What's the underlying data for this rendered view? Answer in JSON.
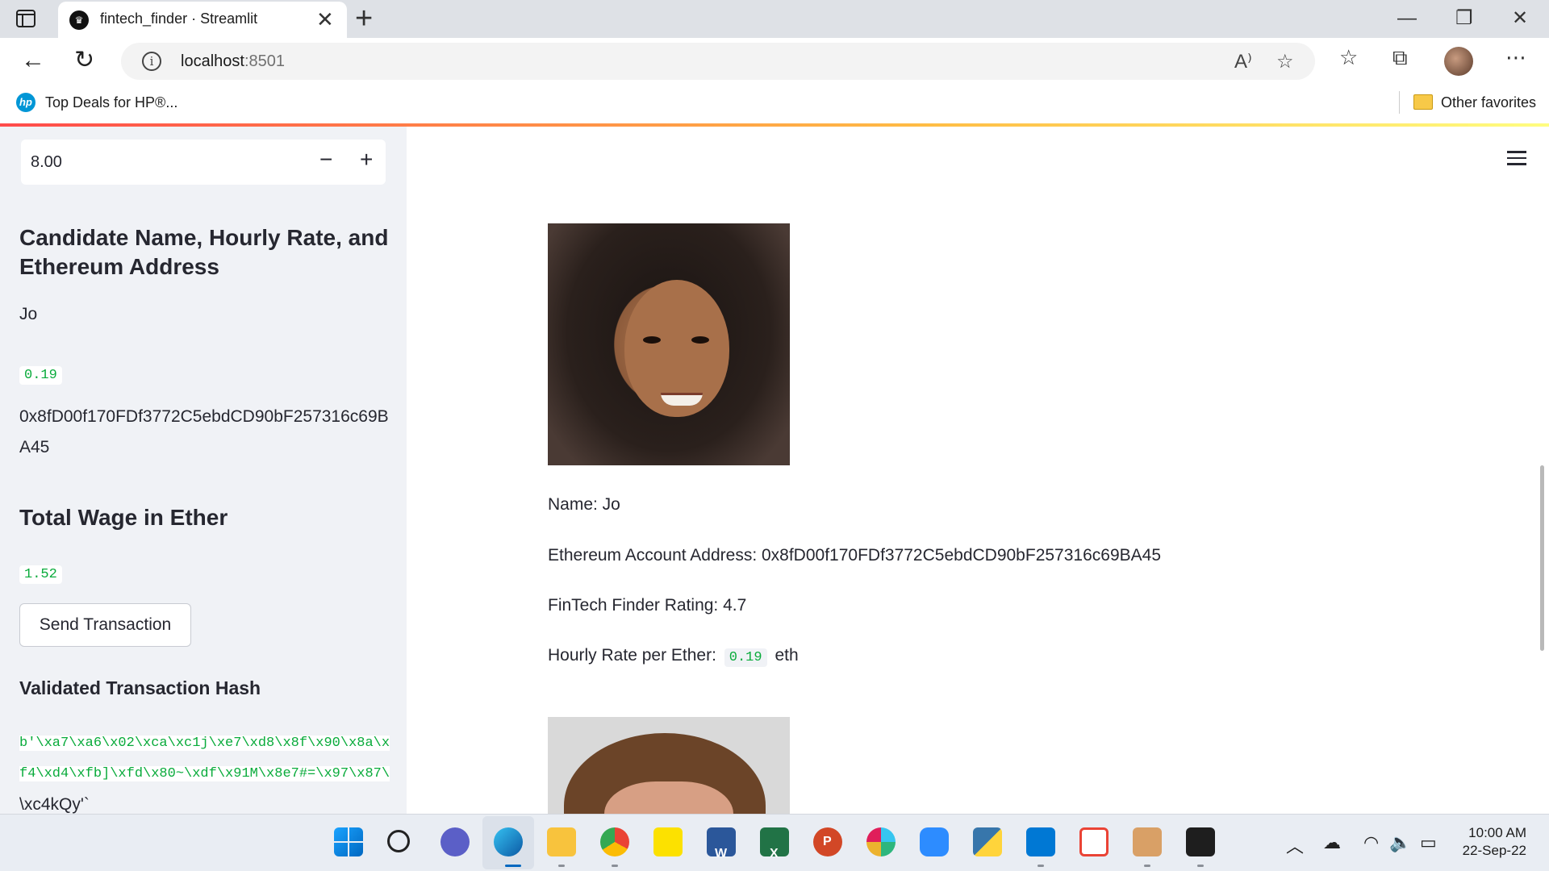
{
  "browser": {
    "tab_title": "fintech_finder · Streamlit",
    "tab_close": "✕",
    "new_tab": "+",
    "url_host": "localhost",
    "url_port": ":8501",
    "read_aloud": "A⁾",
    "fav_left": "Top Deals for HP®...",
    "fav_right": "Other favorites",
    "window_minimize": "—",
    "window_restore": "❐",
    "window_close": "✕"
  },
  "sidebar": {
    "hours_input_value": "8.00",
    "minus_label": "−",
    "plus_label": "+",
    "candidate_heading": "Candidate Name, Hourly Rate, and Ethereum Address",
    "candidate_name": "Jo",
    "candidate_rate": "0.19",
    "candidate_address": "0x8fD00f170FDf3772C5ebdCD90bF257316c69BA45",
    "total_wage_heading": "Total Wage in Ether",
    "total_wage_value": "1.52",
    "send_button_label": "Send Transaction",
    "hash_heading": "Validated Transaction Hash",
    "hash_code": "b'\\xa7\\xa6\\x02\\xca\\xc1j\\xe7\\xd8\\x8f\\x90\\x8a\\xf4\\xd4\\xfb]\\xfd\\x80~\\xdf\\x91M\\x8e7#=\\x97\\x87\\",
    "hash_plain": "\\xc4kQy'`"
  },
  "main": {
    "name_line": "Name: Jo",
    "address_line": "Ethereum Account Address: 0x8fD00f170FDf3772C5ebdCD90bF257316c69BA45",
    "rating_line": "FinTech Finder Rating: 4.7",
    "rate_prefix": "Hourly Rate per Ether:",
    "rate_value": "0.19",
    "rate_suffix": "eth"
  },
  "taskbar": {
    "word_letter": "W",
    "excel_letter": "X",
    "ppt_letter": "P",
    "clock_time": "10:00 AM",
    "clock_date": "22-Sep-22"
  },
  "colors": {
    "accent_red": "#ff4b4b",
    "code_green": "#09ab3b",
    "sidebar_bg": "#f0f2f6",
    "text": "#262730"
  },
  "icons": [
    "tab-actions-icon",
    "streamlit-favicon",
    "close-icon",
    "plus-icon",
    "back-arrow-icon",
    "refresh-icon",
    "info-icon",
    "read-aloud-icon",
    "add-favorite-icon",
    "favorites-icon",
    "collections-icon",
    "profile-avatar",
    "more-icon",
    "hp-logo-icon",
    "folder-icon",
    "hamburger-menu-icon"
  ]
}
